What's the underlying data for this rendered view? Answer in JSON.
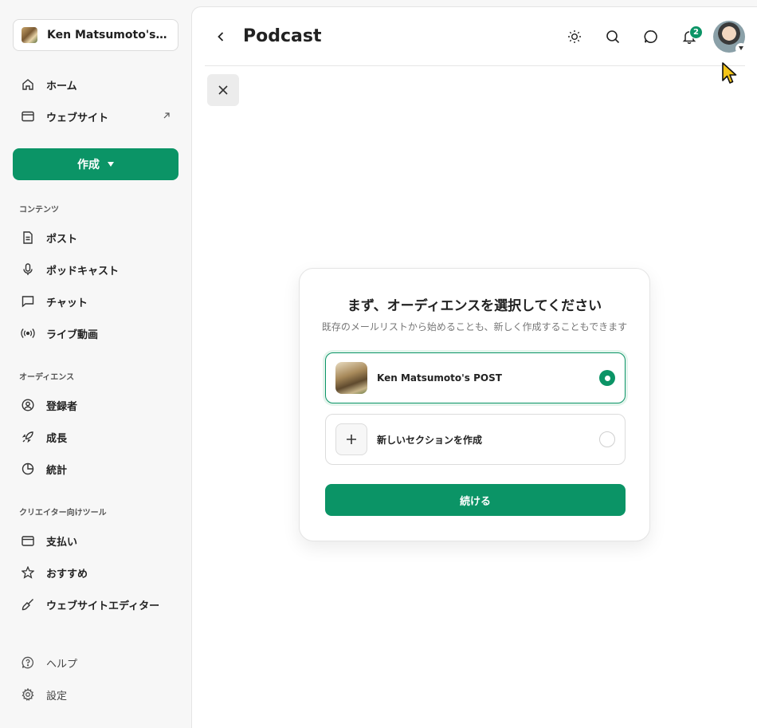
{
  "sidebar": {
    "publication": "Ken Matsumoto's PO...",
    "top_items": [
      {
        "label": "ホーム",
        "icon": "home-icon"
      },
      {
        "label": "ウェブサイト",
        "icon": "browser-icon"
      }
    ],
    "create_label": "作成",
    "sections": [
      {
        "label": "コンテンツ",
        "items": [
          {
            "label": "ポスト",
            "icon": "document-icon"
          },
          {
            "label": "ポッドキャスト",
            "icon": "microphone-icon"
          },
          {
            "label": "チャット",
            "icon": "chat-icon"
          },
          {
            "label": "ライブ動画",
            "icon": "broadcast-icon"
          }
        ]
      },
      {
        "label": "オーディエンス",
        "items": [
          {
            "label": "登録者",
            "icon": "user-circle-icon"
          },
          {
            "label": "成長",
            "icon": "rocket-icon"
          },
          {
            "label": "統計",
            "icon": "pie-chart-icon"
          }
        ]
      },
      {
        "label": "クリエイター向けツール",
        "items": [
          {
            "label": "支払い",
            "icon": "credit-card-icon"
          },
          {
            "label": "おすすめ",
            "icon": "star-icon"
          },
          {
            "label": "ウェブサイトエディター",
            "icon": "paintbrush-icon"
          }
        ]
      }
    ],
    "bottom_items": [
      {
        "label": "ヘルプ",
        "icon": "help-icon"
      },
      {
        "label": "設定",
        "icon": "gear-icon"
      }
    ]
  },
  "header": {
    "title": "Podcast",
    "notification_count": "2"
  },
  "modal": {
    "title": "まず、オーディエンスを選択してください",
    "subtitle": "既存のメールリストから始めることも、新しく作成することもできます",
    "options": [
      {
        "label": "Ken Matsumoto's POST",
        "selected": true
      },
      {
        "label": "新しいセクションを作成",
        "selected": false
      }
    ],
    "continue_label": "続ける"
  },
  "colors": {
    "accent": "#0b9466",
    "sidebar_bg": "#f7f7f7",
    "main_bg": "#ffffff"
  }
}
